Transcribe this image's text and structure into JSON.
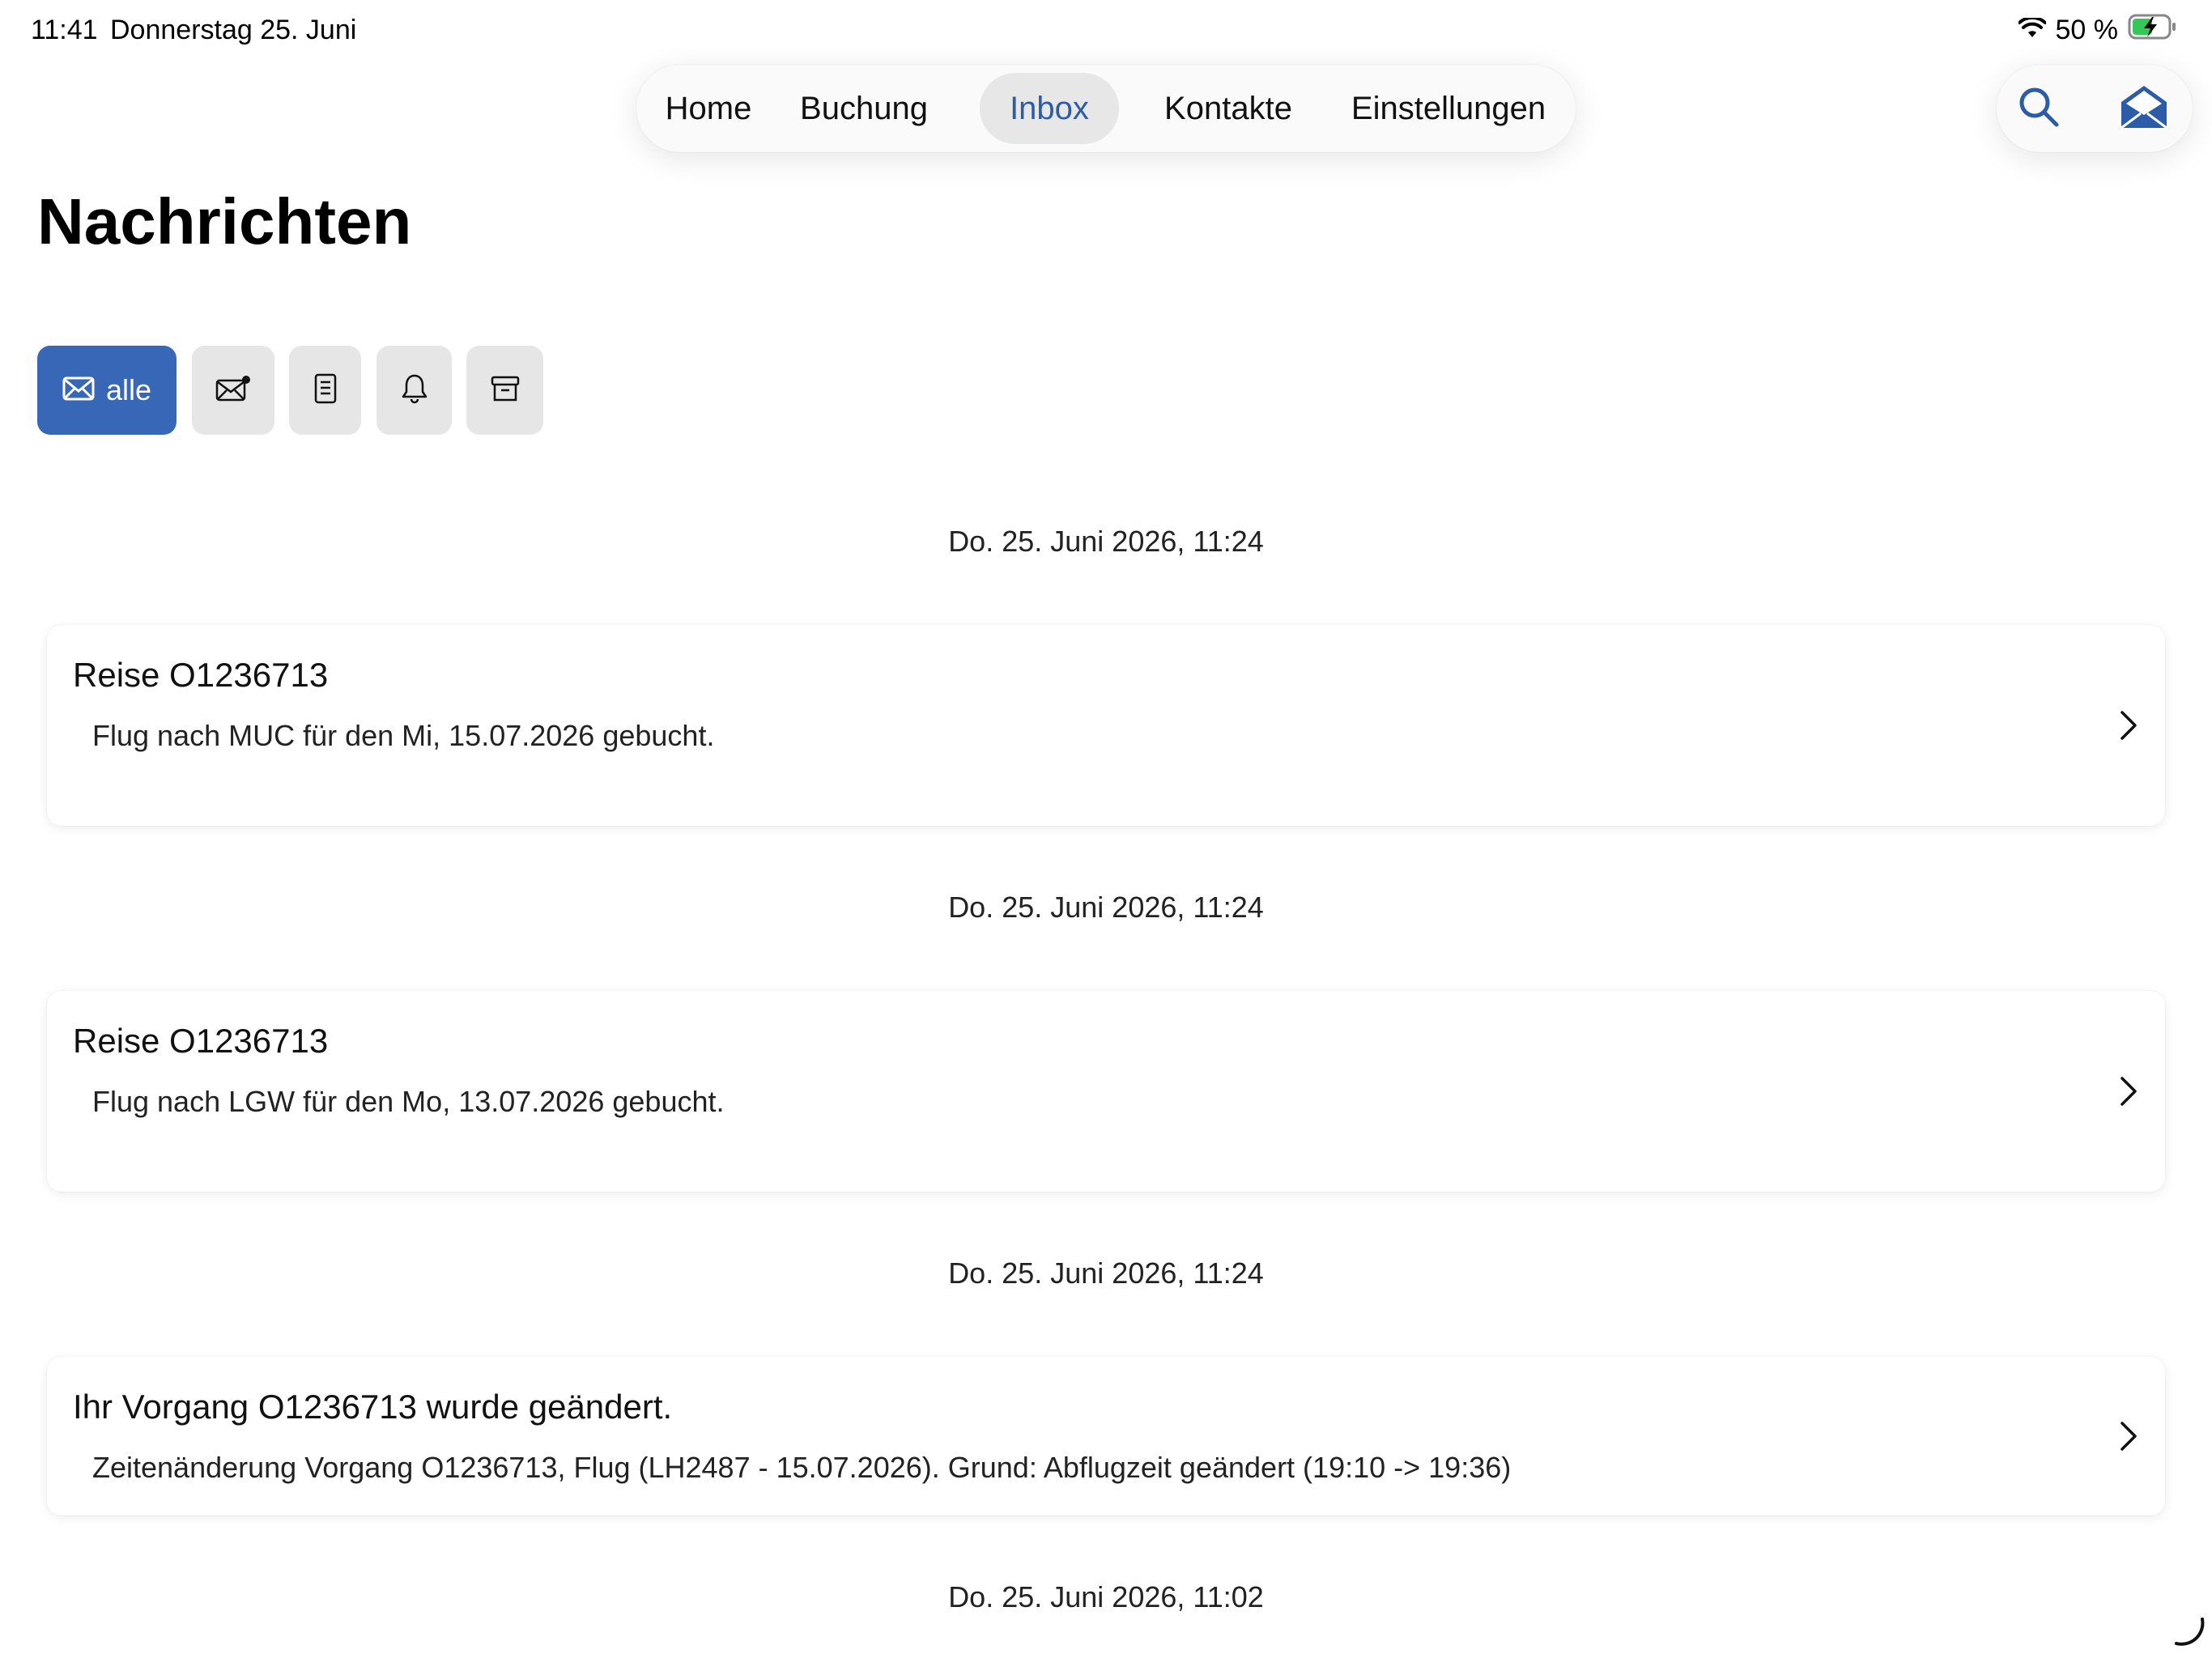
{
  "status_bar": {
    "time": "11:41",
    "date": "Donnerstag 25. Juni",
    "battery": "50 %",
    "wifi_icon": "wifi-icon",
    "battery_icon": "battery-charging-icon"
  },
  "nav": {
    "tabs": [
      {
        "label": "Home",
        "active": false
      },
      {
        "label": "Buchung",
        "active": false
      },
      {
        "label": "Inbox",
        "active": true
      },
      {
        "label": "Kontakte",
        "active": false
      },
      {
        "label": "Einstellungen",
        "active": false
      }
    ],
    "accent_color": "#2c5ca8"
  },
  "actions": {
    "search_icon": "search-icon",
    "mail_icon": "mail-open-icon"
  },
  "page": {
    "title": "Nachrichten"
  },
  "filters": {
    "items": [
      {
        "icon": "envelope-icon",
        "label": "alle",
        "active": true
      },
      {
        "icon": "envelope-unread-icon",
        "label": "",
        "active": false
      },
      {
        "icon": "document-icon",
        "label": "",
        "active": false
      },
      {
        "icon": "bell-icon",
        "label": "",
        "active": false
      },
      {
        "icon": "archive-icon",
        "label": "",
        "active": false
      }
    ],
    "active_color": "#3767b6"
  },
  "messages": [
    {
      "date": "Do. 25. Juni 2026, 11:24",
      "title": "Reise O1236713",
      "body": "Flug nach MUC für den Mi, 15.07.2026 gebucht."
    },
    {
      "date": "Do. 25. Juni 2026, 11:24",
      "title": "Reise O1236713",
      "body": "Flug nach LGW für den Mo, 13.07.2026 gebucht."
    },
    {
      "date": "Do. 25. Juni 2026, 11:24",
      "title": "Ihr Vorgang O1236713 wurde geändert.",
      "body": "Zeitenänderung Vorgang O1236713, Flug (LH2487 - 15.07.2026). Grund: Abflugzeit geändert (19:10 -> 19:36)"
    }
  ],
  "trailing_date": "Do. 25. Juni 2026, 11:02"
}
